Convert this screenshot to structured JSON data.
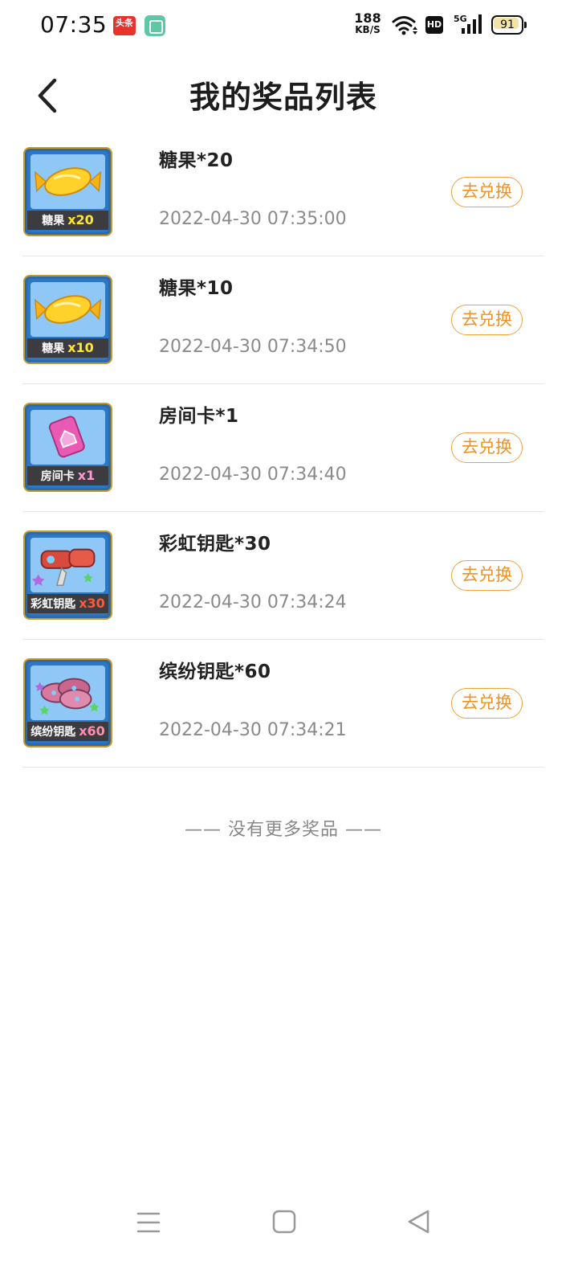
{
  "status_bar": {
    "time": "07:35",
    "toutiao_icon_text": "头条",
    "net_speed_value": "188",
    "net_speed_unit": "KB/S",
    "hd_label": "HD",
    "signal_label": "5G",
    "battery_level": "91",
    "battery_fraction": 0.91
  },
  "header": {
    "title": "我的奖品列表",
    "back_icon": "chevron-left-icon"
  },
  "prizes": [
    {
      "name": "糖果*20",
      "time": "2022-04-30 07:35:00",
      "action": "去兑换",
      "thumb_label": "糖果",
      "thumb_qty": "x20",
      "qty_color": "#ffe82a",
      "art": "candy"
    },
    {
      "name": "糖果*10",
      "time": "2022-04-30 07:34:50",
      "action": "去兑换",
      "thumb_label": "糖果",
      "thumb_qty": "x10",
      "qty_color": "#ffe82a",
      "art": "candy"
    },
    {
      "name": "房间卡*1",
      "time": "2022-04-30 07:34:40",
      "action": "去兑换",
      "thumb_label": "房间卡",
      "thumb_qty": "x1",
      "qty_color": "#ff9ad0",
      "art": "room-card"
    },
    {
      "name": "彩虹钥匙*30",
      "time": "2022-04-30 07:34:24",
      "action": "去兑换",
      "thumb_label": "彩虹钥匙",
      "thumb_qty": "x30",
      "qty_color": "#ff5a3a",
      "art": "rainbow-key"
    },
    {
      "name": "缤纷钥匙*60",
      "time": "2022-04-30 07:34:21",
      "action": "去兑换",
      "thumb_label": "缤纷钥匙",
      "thumb_qty": "x60",
      "qty_color": "#ff8fb0",
      "art": "colorful-key"
    }
  ],
  "footer_text": "—— 没有更多奖品 ——",
  "nav_bar": {
    "menu_icon": "menu-icon",
    "home_icon": "home-square-icon",
    "back_icon": "back-triangle-icon"
  },
  "colors": {
    "accent_orange": "#ef9224",
    "divider": "#e6e6e6",
    "thumb_border": "#c49a2a",
    "thumb_bg": "#8fc8f6"
  }
}
